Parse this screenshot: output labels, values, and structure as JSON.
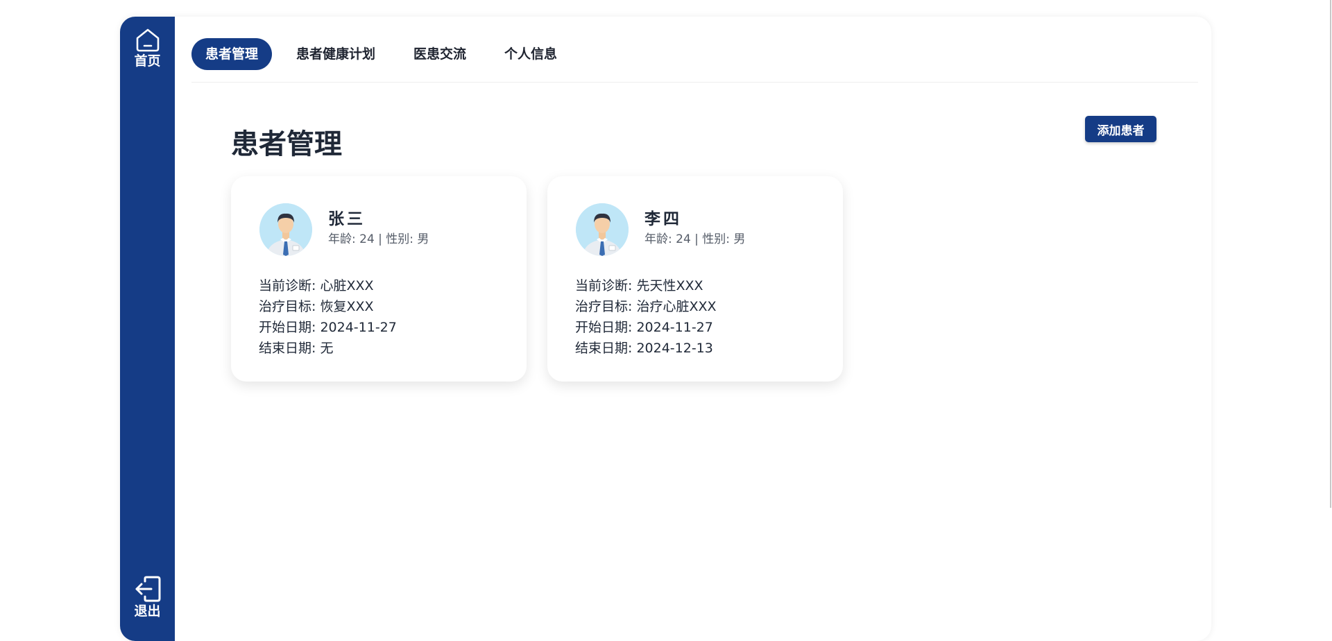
{
  "sidebar": {
    "home_label": "首页",
    "logout_label": "退出"
  },
  "nav": {
    "tabs": [
      {
        "label": "患者管理",
        "active": true
      },
      {
        "label": "患者健康计划",
        "active": false
      },
      {
        "label": "医患交流",
        "active": false
      },
      {
        "label": "个人信息",
        "active": false
      }
    ]
  },
  "main": {
    "title": "患者管理",
    "add_button": "添加患者"
  },
  "patients": [
    {
      "name": "张三",
      "meta": "年龄: 24 | 性别: 男",
      "diagnosis": "当前诊断: 心脏XXX",
      "goal": "治疗目标: 恢复XXX",
      "start": "开始日期: 2024-11-27",
      "end": "结束日期: 无"
    },
    {
      "name": "李四",
      "meta": "年龄: 24 | 性别: 男",
      "diagnosis": "当前诊断: 先天性XXX",
      "goal": "治疗目标: 治疗心脏XXX",
      "start": "开始日期: 2024-11-27",
      "end": "结束日期: 2024-12-13"
    }
  ],
  "colors": {
    "primary": "#153c86",
    "text": "#1f2837",
    "muted": "#555c68",
    "avatar_bg": "#bfe6f7"
  }
}
